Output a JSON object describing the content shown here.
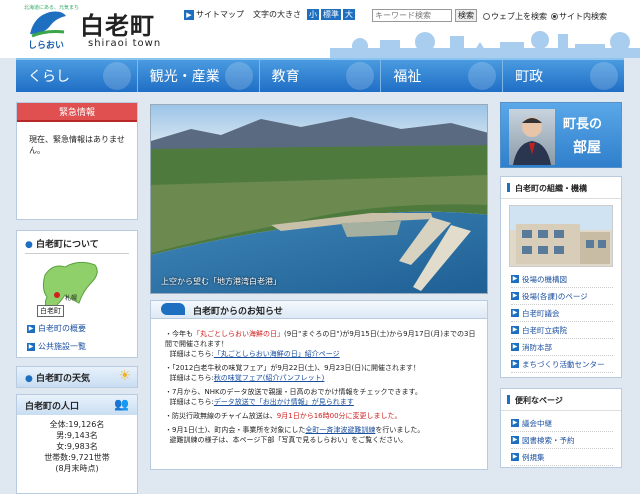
{
  "header": {
    "tagline": "北海道にある、元気まち",
    "kana": "しらおい",
    "town_jp": "白老町",
    "town_en": "shiraoi town",
    "sitemap": "サイトマップ",
    "font_size_label": "文字の大きさ",
    "font_sizes": [
      "小",
      "標準",
      "大"
    ],
    "search_placeholder": "キーワード検索",
    "search_button": "検索",
    "radio_web": "ウェブ上を検索",
    "radio_site": "サイト内検索"
  },
  "nav": [
    "くらし",
    "観光・産業",
    "教育",
    "福祉",
    "町政"
  ],
  "left": {
    "emergency_title": "緊急情報",
    "emergency_text": "現在、緊急情報はありません。",
    "about_title": "白老町について",
    "map_label_sapporo": "札幌",
    "map_label_town": "白老町",
    "about_links": [
      "白老町の概要",
      "公共施設一覧"
    ],
    "weather_title": "白老町の天気",
    "population_title": "白老町の人口",
    "population_rows": [
      "全体:19,126名",
      "男:9,143名",
      "女:9,983名",
      "世帯数:9,721世帯",
      "(8月末時点)"
    ]
  },
  "center": {
    "photo_caption": "上空から望む「地方港湾白老港」",
    "news_title": "白老町からのお知らせ",
    "news": [
      {
        "pre": "今年も",
        "hl": "「丸ごとしらおい海鮮の日」",
        "post": "(9日\"まぐろの日\")が9月15日(土)から9月17日(月)までの3日間で開催されます！",
        "detail_label": "詳細はこちら:",
        "detail_link": "「丸ごとしらおい海鮮の日」紹介ページ"
      },
      {
        "pre": "「2012白老牛秋の味覚フェア」が9月22日(土)、9月23日(日)に開催されます！",
        "hl": "",
        "post": "",
        "detail_label": "詳細はこちら:",
        "detail_link": "秋の味覚フェア(紹介パンフレット)"
      },
      {
        "pre": "7月から、NHKのデータ放送で親援・日高のおでかけ情報をチェックできます。",
        "hl": "",
        "post": "",
        "detail_label": "詳細はこちら:",
        "detail_link": "データ放送で「お出かけ情報」が見られます"
      },
      {
        "pre": "防災行政無線のチャイム放送は、",
        "hl": "9月1日から16時00分に変更しました。",
        "post": "",
        "detail_label": "",
        "detail_link": ""
      },
      {
        "pre": "9月1日(土)、町内会・事業所を対象にした",
        "hl": "全町一斉津波避難訓練",
        "post": "を行いました。",
        "detail_label": "避難訓練の様子は、本ページ下部「写真で見るしらおい」をご覧ください。",
        "detail_link": ""
      }
    ]
  },
  "right": {
    "mayor_line1": "町長の",
    "mayor_line2": "部屋",
    "org_title": "白老町の組織・機構",
    "org_links": [
      "役場の機構図",
      "役場(各課)のページ",
      "白老町議会",
      "白老町立病院",
      "消防本部",
      "まちづくり活動センター"
    ],
    "useful_title": "便利なページ",
    "useful_links": [
      "議会中継",
      "図書検索・予約",
      "例規集"
    ]
  },
  "colors": {
    "nav_blue": "#1f6ec6",
    "emergency_red": "#e05050",
    "link_blue": "#1a4fa0",
    "highlight_red": "#d02020"
  }
}
